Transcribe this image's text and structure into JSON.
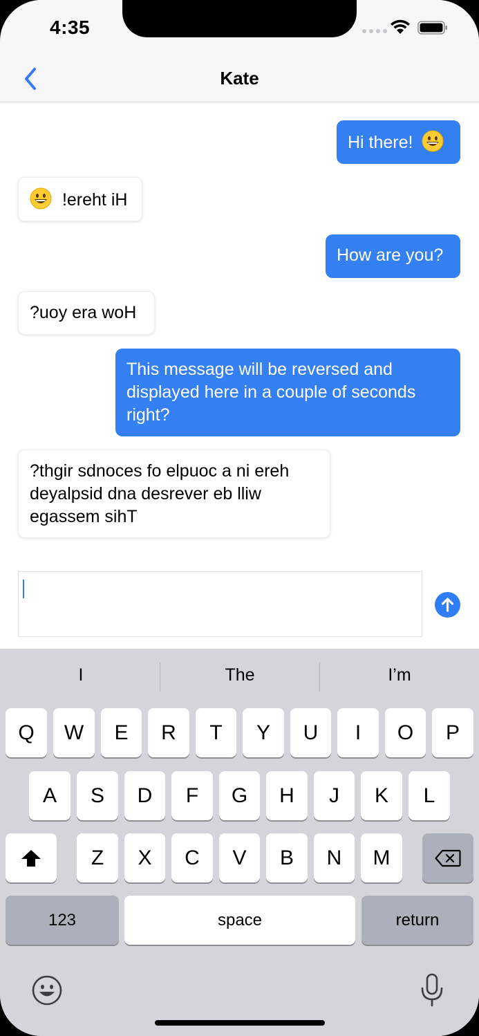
{
  "status_bar": {
    "time": "4:35"
  },
  "nav": {
    "title": "Kate",
    "back_icon": "chevron-left-icon"
  },
  "messages": [
    {
      "type": "sent",
      "text": "Hi there!",
      "emoji": "grinning-face"
    },
    {
      "type": "received",
      "text": "!ereht iH",
      "emoji": "grinning-face"
    },
    {
      "type": "sent",
      "text": "How are you?"
    },
    {
      "type": "received",
      "text": "?uoy era woH"
    },
    {
      "type": "sent",
      "lines": [
        "This message will be reversed and",
        "displayed here in a couple of seconds",
        "right?"
      ]
    },
    {
      "type": "received",
      "lines": [
        "?thgir sdnoces fo elpuoc a ni ereh",
        "deyalpsid dna desrever eb lliw",
        "egassem sihT"
      ]
    }
  ],
  "composer": {
    "value": "",
    "send_icon": "arrow-up-circle-icon"
  },
  "keyboard": {
    "suggestions": [
      "I",
      "The",
      "I’m"
    ],
    "row1": [
      "Q",
      "W",
      "E",
      "R",
      "T",
      "Y",
      "U",
      "I",
      "O",
      "P"
    ],
    "row2": [
      "A",
      "S",
      "D",
      "F",
      "G",
      "H",
      "J",
      "K",
      "L"
    ],
    "row3": [
      "Z",
      "X",
      "C",
      "V",
      "B",
      "N",
      "M"
    ],
    "numbers_label": "123",
    "space_label": "space",
    "return_label": "return",
    "icons": {
      "shift": "shift-icon",
      "delete": "delete-icon",
      "emoji": "emoji-icon",
      "mic": "microphone-icon"
    }
  },
  "colors": {
    "accent": "#3480f2",
    "keyboard_bg": "#d3d5db",
    "dark_key": "#abb0ba"
  }
}
